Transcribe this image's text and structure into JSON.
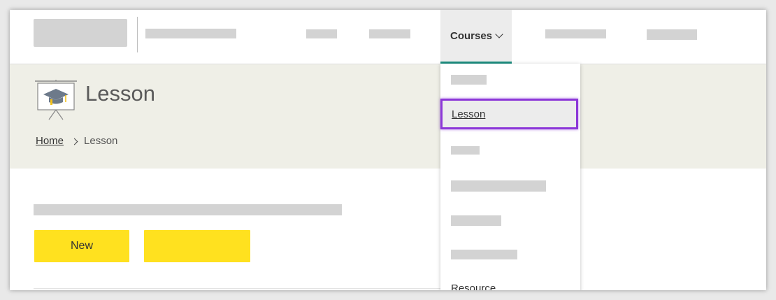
{
  "header": {
    "nav_active_label": "Courses"
  },
  "hero": {
    "title": "Lesson",
    "breadcrumb": {
      "home": "Home",
      "current": "Lesson"
    }
  },
  "main": {
    "new_button_label": "New"
  },
  "dropdown": {
    "items": {
      "lesson": "Lesson",
      "resource": "Resource"
    }
  },
  "colors": {
    "accent_teal": "#1d8f80",
    "button_yellow": "#ffe11f",
    "highlight_purple": "#8c37d8",
    "hero_background": "#efefe7"
  }
}
